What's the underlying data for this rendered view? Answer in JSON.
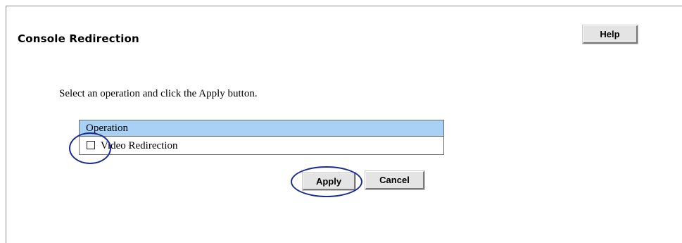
{
  "page": {
    "title": "Console Redirection",
    "help_label": "Help",
    "instruction": "Select an operation and click the Apply button."
  },
  "operations_table": {
    "header": "Operation",
    "rows": [
      {
        "label": "Video Redirection",
        "checked": false
      }
    ]
  },
  "actions": {
    "apply_label": "Apply",
    "cancel_label": "Cancel"
  },
  "annotations": {
    "highlight_color": "#1c2b8f",
    "highlighted": [
      "video-redirection-checkbox",
      "apply-button"
    ]
  },
  "colors": {
    "table_header_bg": "#a9d0f5",
    "button_bg": "#e4e4e4"
  }
}
